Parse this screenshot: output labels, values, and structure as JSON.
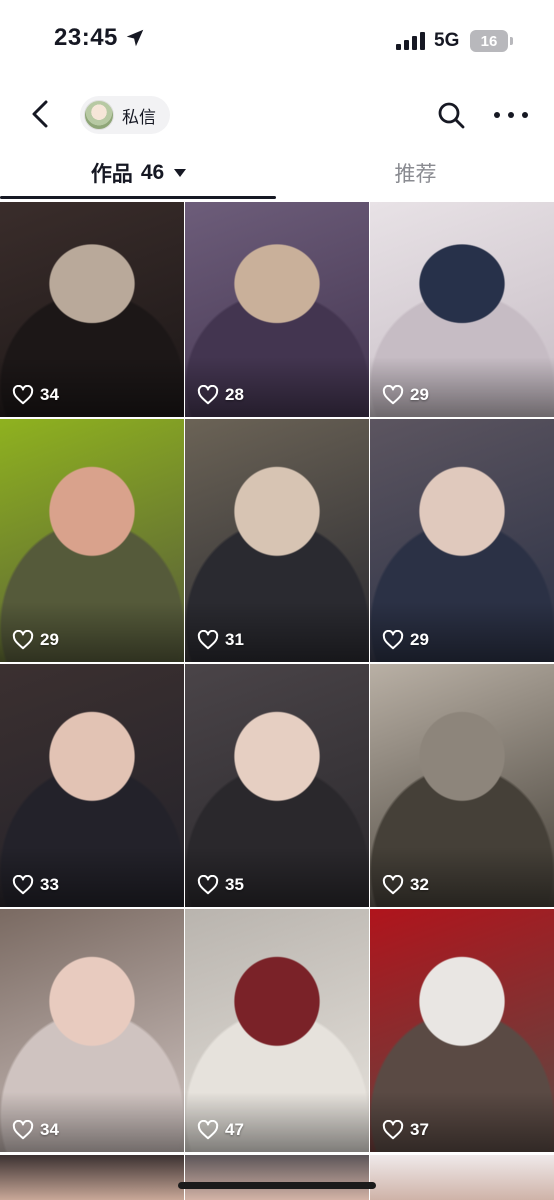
{
  "status_bar": {
    "time": "23:45",
    "network": "5G",
    "battery": "16"
  },
  "nav": {
    "dm_label": "私信"
  },
  "tabs": {
    "works_label": "作品",
    "works_count": "46",
    "recommend_label": "推荐"
  },
  "videos": [
    {
      "likes": "34",
      "colors": [
        "#3a2d2b",
        "#b9a99a",
        "#1c1717"
      ]
    },
    {
      "likes": "28",
      "colors": [
        "#6d5d7a",
        "#c9b09a",
        "#433550"
      ]
    },
    {
      "likes": "29",
      "colors": [
        "#e8e2e6",
        "#27314a",
        "#c6bcc4"
      ]
    },
    {
      "likes": "29",
      "colors": [
        "#8fb21f",
        "#d9a28c",
        "#555a3a"
      ]
    },
    {
      "likes": "31",
      "colors": [
        "#6b6356",
        "#d7c4b3",
        "#2a2a30"
      ]
    },
    {
      "likes": "29",
      "colors": [
        "#5c5560",
        "#e0c9bd",
        "#2b3145"
      ]
    },
    {
      "likes": "33",
      "colors": [
        "#3b3030",
        "#e2c3b4",
        "#23222a"
      ]
    },
    {
      "likes": "35",
      "colors": [
        "#4a4448",
        "#e6cfc2",
        "#2a282c"
      ]
    },
    {
      "likes": "32",
      "colors": [
        "#b9b0a5",
        "#8d857b",
        "#454038"
      ]
    },
    {
      "likes": "34",
      "colors": [
        "#7a6a62",
        "#e8cbbf",
        "#cfc3c0"
      ]
    },
    {
      "likes": "47",
      "colors": [
        "#b9b4ae",
        "#7a2228",
        "#e6e2dc"
      ]
    },
    {
      "likes": "37",
      "colors": [
        "#b0141c",
        "#e9e6e3",
        "#5a4a44"
      ]
    }
  ]
}
